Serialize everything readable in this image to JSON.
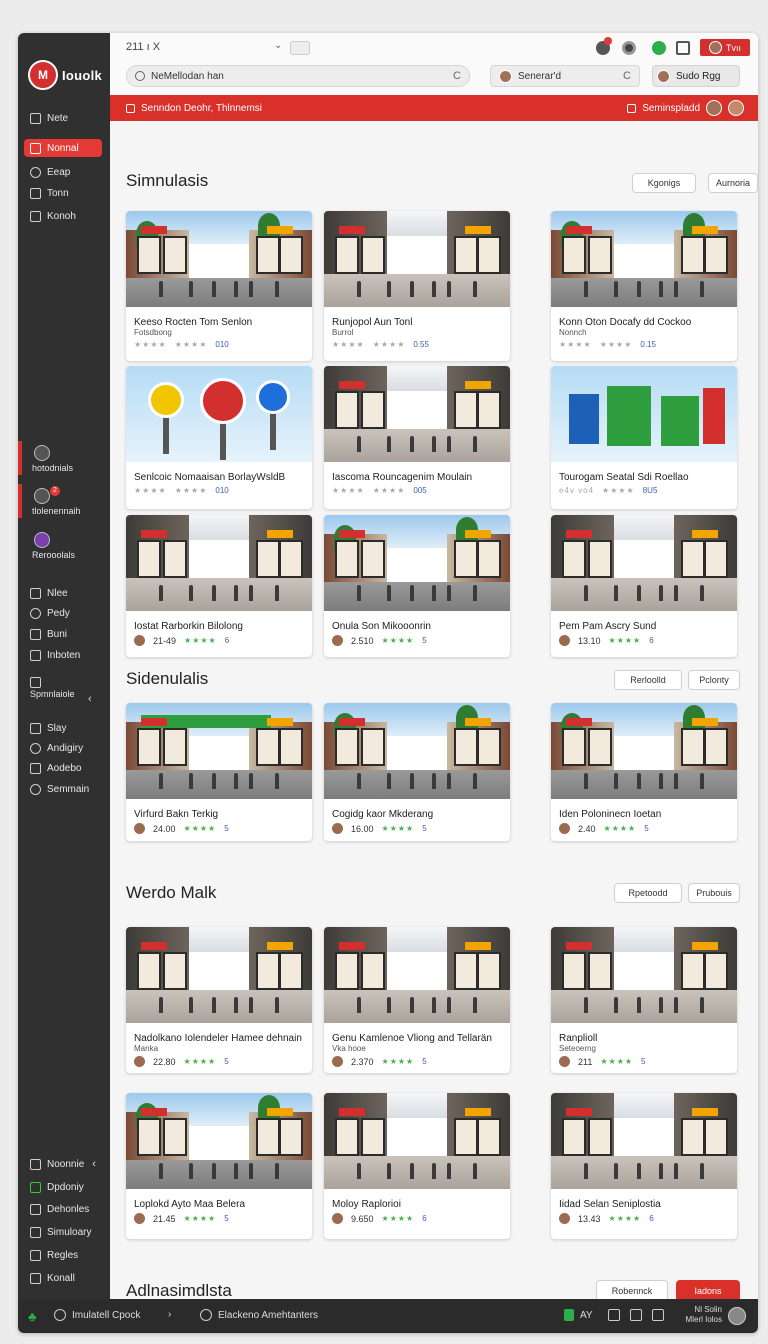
{
  "app": {
    "logo_text": "Iouolk",
    "tab_title": "211 ı X",
    "top_user_button": "Tvıı"
  },
  "search": {
    "main_value": "NeMellodan han",
    "secondary_value": "Senerar'd",
    "user_label": "Sudo Rgg"
  },
  "banner": {
    "left_text": "Senndon Deohr,  Thlnnemsi",
    "right_text": "Seminspladd"
  },
  "sidebar": {
    "top_items": [
      {
        "label": "Nete",
        "icon": "menu-icon"
      },
      {
        "label": "Nonnal",
        "icon": "home-icon",
        "active": true
      },
      {
        "label": "Eeap",
        "icon": "circle-icon"
      },
      {
        "label": "Tonn",
        "icon": "tag-icon"
      },
      {
        "label": "Konoh",
        "icon": "chat-icon"
      }
    ],
    "channels": [
      {
        "label": "hotodnials",
        "badge": ""
      },
      {
        "label": "tlolenennaih",
        "badge": "2"
      },
      {
        "label": "Rerooolals",
        "badge": ""
      }
    ],
    "mid_items": [
      {
        "label": "Nlee",
        "icon": "grid-icon"
      },
      {
        "label": "Pedy",
        "icon": "user-icon"
      },
      {
        "label": "Buni",
        "icon": "mail-icon"
      },
      {
        "label": "Inboten",
        "icon": "bell-icon"
      }
    ],
    "section_label": "Spmnlaiole",
    "lower_items": [
      {
        "label": "Slay",
        "icon": "edit-icon"
      },
      {
        "label": "Andigiry",
        "icon": "globe-icon"
      },
      {
        "label": "Aodebo",
        "icon": "chart-icon"
      },
      {
        "label": "Semmain",
        "icon": "search-icon"
      }
    ],
    "bottom_items": [
      {
        "label": "Noonnie",
        "icon": "square-icon",
        "chev": true
      },
      {
        "label": "Dpdoniy",
        "icon": "square-icon",
        "green": true
      },
      {
        "label": "Dehonles",
        "icon": "list-icon"
      },
      {
        "label": "Simuloary",
        "icon": "doc-icon"
      },
      {
        "label": "Regles",
        "icon": "file-icon"
      },
      {
        "label": "Konall",
        "icon": "chat-icon"
      }
    ]
  },
  "sections": [
    {
      "title": "Simnulasis",
      "buttons": [
        "Kgonigs",
        "Aurnoria"
      ],
      "cards": [
        {
          "title": "Keeso Rocten Tom Senlon",
          "sub": "Fotsdbong",
          "meta_l": "★★★★",
          "meta_m": "★★★★",
          "val": "010",
          "style": "outdoor"
        },
        {
          "title": "Runjopol Aun Tonl",
          "sub": "Burrol",
          "meta_l": "★★★★",
          "meta_m": "★★★★",
          "val": "0.55",
          "style": "indoor"
        },
        {
          "title": "Konn Oton Docafy dd Cockoo",
          "sub": "Nonnch",
          "meta_l": "★★★★",
          "meta_m": "★★★★",
          "val": "0.15",
          "style": "outdoor"
        },
        {
          "title": "Senlcoic Nomaaisan BorlayWsldB",
          "sub": "",
          "meta_l": "★★★★",
          "meta_m": "★★★★",
          "val": "010",
          "style": "bubbles"
        },
        {
          "title": "Iascoma Rouncagenim Moulain",
          "sub": "",
          "meta_l": "★★★★",
          "meta_m": "★★★★",
          "val": "005",
          "style": "indoor"
        },
        {
          "title": "Tourogam Seatal Sdi Roellao",
          "sub": "",
          "meta_l": "e4v vo4",
          "meta_m": "★★★★",
          "val": "8U5",
          "style": "tiles"
        },
        {
          "title": "Iostat Rarborkin Bilolong",
          "sub": "",
          "count": "21-49",
          "stars": "★★★★",
          "val": "6",
          "style": "indoor"
        },
        {
          "title": "Onula Son Mikooonrin",
          "sub": "",
          "count": "2.510",
          "stars": "★★★★",
          "val": "5",
          "style": "outdoor"
        },
        {
          "title": "Pem Pam Ascry Sund",
          "sub": "",
          "count": "13.10",
          "stars": "★★★★",
          "val": "6",
          "style": "indoor"
        }
      ]
    },
    {
      "title": "Sidenulalis",
      "buttons": [
        "Rerloolld",
        "Pclonty"
      ],
      "cards": [
        {
          "title": "Virfurd Bakn Terkig",
          "sub": "",
          "count": "24.00",
          "stars": "★★★★",
          "val": "5",
          "style": "storefront"
        },
        {
          "title": "Cogidg kaor Mkderang",
          "sub": "",
          "count": "16.00",
          "stars": "★★★★",
          "val": "5",
          "style": "outdoor"
        },
        {
          "title": "Iden Poloninecn Ioetan",
          "sub": "",
          "count": "2.40",
          "stars": "★★★★",
          "val": "5",
          "style": "outdoor"
        }
      ]
    },
    {
      "title": "Werdo Malk",
      "buttons": [
        "Rpetoodd",
        "Prubouis"
      ],
      "cards": [
        {
          "title": "Nadolkano Iolendeler Hamee dehnain",
          "sub": "Manka",
          "count": "22.80",
          "stars": "★★★★",
          "val": "5",
          "style": "indoor"
        },
        {
          "title": "Genu Kamlenoe Vliong and Tellarän",
          "sub": "Vka hooe",
          "count": "2.370",
          "stars": "★★★★",
          "val": "5",
          "style": "indoor"
        },
        {
          "title": "Ranplioll",
          "sub": "Seteoerng",
          "count": "211",
          "stars": "★★★★",
          "val": "5",
          "style": "indoor"
        },
        {
          "title": "Loplokd Ayto Maa Belera",
          "sub": "",
          "count": "21.45",
          "stars": "★★★★",
          "val": "5",
          "style": "outdoor"
        },
        {
          "title": "Moloy Raplorioi",
          "sub": "",
          "count": "9.650",
          "stars": "★★★★",
          "val": "6",
          "style": "indoor"
        },
        {
          "title": "Iidad Selan Seniplostia",
          "sub": "",
          "count": "13.43",
          "stars": "★★★★",
          "val": "6",
          "style": "indoor"
        }
      ]
    }
  ],
  "footer_section": {
    "title": "Adlnasimdlsta",
    "secondary_button": "Robennck",
    "primary_button": "Iadons"
  },
  "bottombar": {
    "left_label": "Imulatell Cpock",
    "search_label": "Elackeno Amehtanters",
    "status_mid": "AY",
    "status_right_1": "Nl Solin",
    "status_right_2": "Mlerl Iolos"
  },
  "colors": {
    "accent": "#d9302a",
    "sidebar": "#303030",
    "star_green": "#4caf50",
    "value_blue": "#3b5fb0"
  }
}
